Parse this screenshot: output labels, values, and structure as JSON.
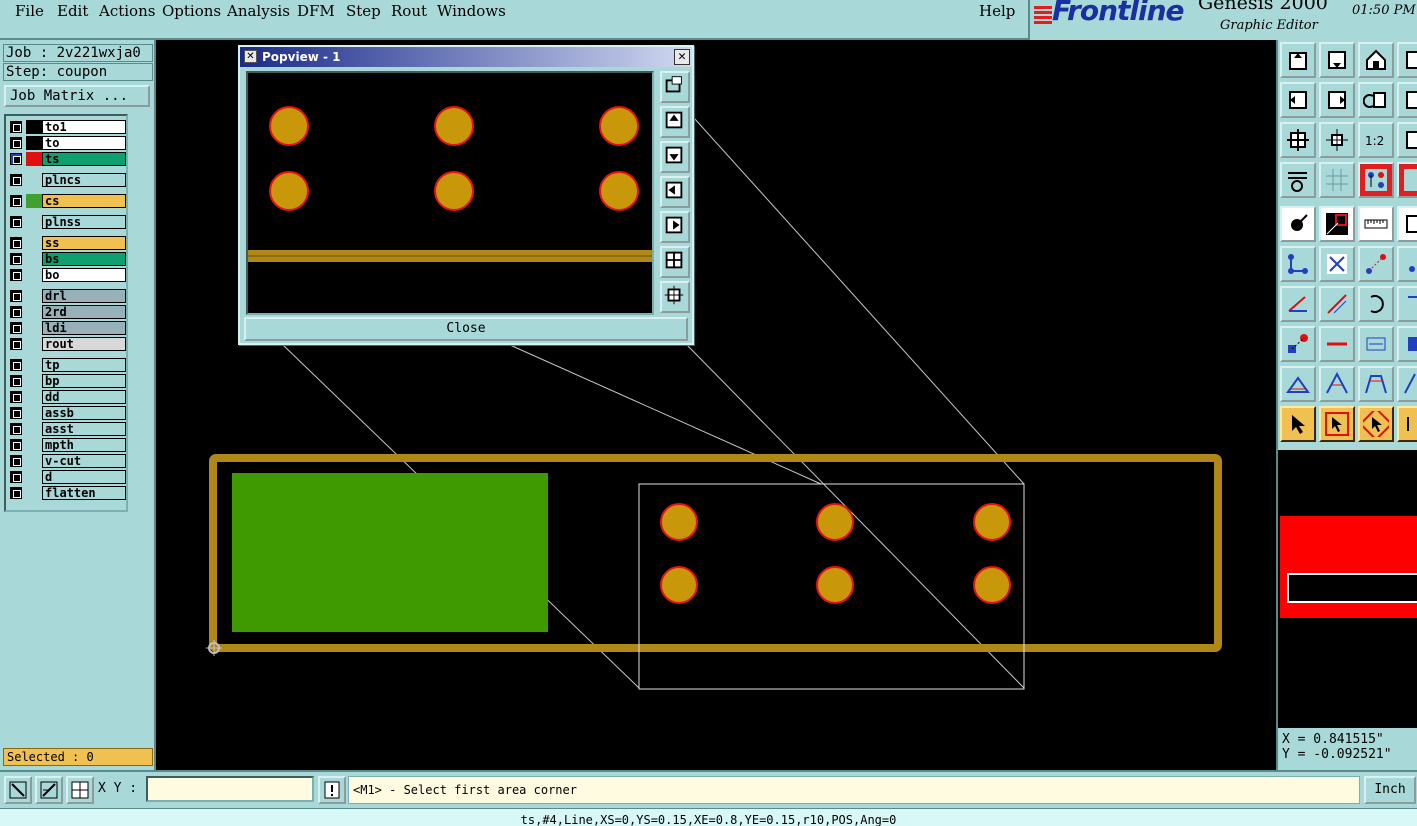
{
  "menu": {
    "items": [
      {
        "label": "File"
      },
      {
        "label": "Edit"
      },
      {
        "label": "Actions"
      },
      {
        "label": "Options"
      },
      {
        "label": "Analysis"
      },
      {
        "label": "DFM"
      },
      {
        "label": "Step"
      },
      {
        "label": "Rout"
      },
      {
        "label": "Windows"
      }
    ],
    "help": "Help"
  },
  "brand": {
    "logo": "Frontline",
    "product": "Genesis 2000",
    "time": "01:50 PM",
    "subtitle": "Graphic Editor"
  },
  "job": {
    "job_line": "Job : 2v221wxja0",
    "step_line": "Step: coupon",
    "matrix_button": "Job Matrix ..."
  },
  "layers": [
    {
      "name": "to1",
      "color": "#ffffff",
      "swatch": "#000000"
    },
    {
      "name": "to",
      "color": "#ffffff",
      "swatch": "#000000"
    },
    {
      "name": "ts",
      "color": "#10a070",
      "swatch": "#e01010",
      "active": true
    },
    {
      "name": "plncs",
      "color": "#a8d8d8",
      "swatch": "#a8d8d8"
    },
    {
      "name": "cs",
      "color": "#f0c050",
      "swatch": "#40a030"
    },
    {
      "name": "plnss",
      "color": "#a8d8d8",
      "swatch": "#a8d8d8"
    },
    {
      "name": "ss",
      "color": "#f0c050",
      "swatch": "#a8d8d8"
    },
    {
      "name": "bs",
      "color": "#10a070",
      "swatch": "#a8d8d8"
    },
    {
      "name": "bo",
      "color": "#ffffff",
      "swatch": "#a8d8d8"
    },
    {
      "name": "drl",
      "color": "#98b0b8",
      "swatch": "#a8d8d8"
    },
    {
      "name": "2rd",
      "color": "#98b0b8",
      "swatch": "#a8d8d8"
    },
    {
      "name": "ldi",
      "color": "#98b0b8",
      "swatch": "#a8d8d8"
    },
    {
      "name": "rout",
      "color": "#d8d8d8",
      "swatch": "#a8d8d8"
    },
    {
      "name": "tp",
      "color": "#a8d8d8",
      "swatch": "#a8d8d8"
    },
    {
      "name": "bp",
      "color": "#a8d8d8",
      "swatch": "#a8d8d8"
    },
    {
      "name": "dd",
      "color": "#a8d8d8",
      "swatch": "#a8d8d8"
    },
    {
      "name": "assb",
      "color": "#a8d8d8",
      "swatch": "#a8d8d8"
    },
    {
      "name": "asst",
      "color": "#a8d8d8",
      "swatch": "#a8d8d8"
    },
    {
      "name": "mpth",
      "color": "#a8d8d8",
      "swatch": "#a8d8d8"
    },
    {
      "name": "v-cut",
      "color": "#a8d8d8",
      "swatch": "#a8d8d8"
    },
    {
      "name": "d",
      "color": "#a8d8d8",
      "swatch": "#a8d8d8"
    },
    {
      "name": "flatten",
      "color": "#a8d8d8",
      "swatch": "#a8d8d8"
    }
  ],
  "selected": "Selected : 0",
  "popview": {
    "title": "Popview - 1",
    "close_label": "Close"
  },
  "coords": {
    "x": "X = 0.841515\"",
    "y": "Y = -0.092521\""
  },
  "bottom": {
    "xy_label": "X Y :",
    "xy_value": "",
    "prompt": "<M1> - Select first area corner",
    "units": "Inch"
  },
  "status": "ts,#4,Line,XS=0,YS=0.15,XE=0.8,YE=0.15,r10,POS,Ang=0",
  "colors": {
    "pad": "#c8980a",
    "pad_outline": "#e81010",
    "copper": "#b08818",
    "green_area": "#3e9a00",
    "ui": "#a8d8d8"
  }
}
